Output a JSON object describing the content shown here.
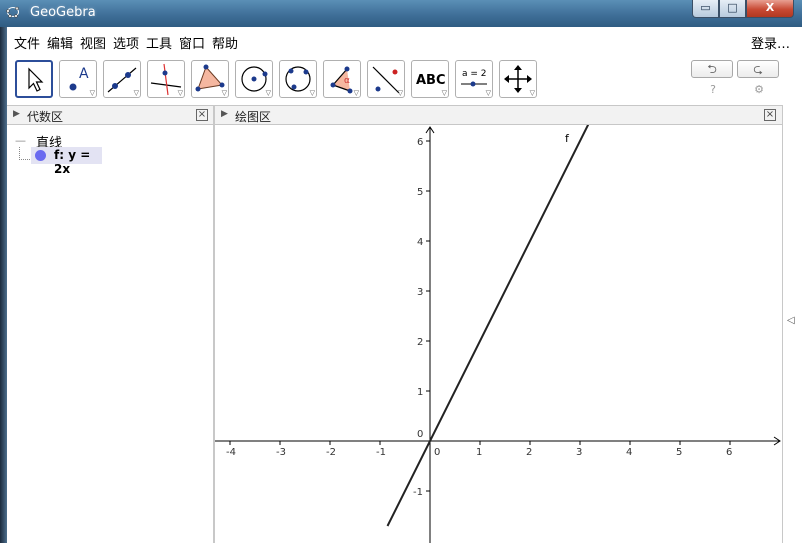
{
  "window": {
    "title": "GeoGebra",
    "controls": {
      "minimize": "▭",
      "maximize": "□",
      "close": "X"
    }
  },
  "menubar": {
    "items": [
      "文件",
      "编辑",
      "视图",
      "选项",
      "工具",
      "窗口",
      "帮助"
    ],
    "login": "登录…"
  },
  "toolbar": {
    "tools": [
      {
        "name": "move-tool"
      },
      {
        "name": "point-tool",
        "text": "A"
      },
      {
        "name": "line-tool"
      },
      {
        "name": "perpendicular-line-tool"
      },
      {
        "name": "polygon-tool"
      },
      {
        "name": "circle-tool"
      },
      {
        "name": "conic-tool"
      },
      {
        "name": "angle-tool",
        "text": "α"
      },
      {
        "name": "reflect-tool"
      },
      {
        "name": "text-tool",
        "text": "ABC"
      },
      {
        "name": "slider-tool",
        "text": "a = 2"
      },
      {
        "name": "move-graphics-tool"
      }
    ],
    "undo": "⮌",
    "redo": "⮎",
    "help": "?",
    "settings": "⚙"
  },
  "algebra_view": {
    "title": "代数区",
    "close": "×",
    "category": "直线",
    "objects": [
      {
        "label": "f: y = 2x",
        "color": "#6b6bf0"
      }
    ]
  },
  "graphics_view": {
    "title": "绘图区",
    "close": "×",
    "x_ticks": [
      "-4",
      "-3",
      "-2",
      "-1",
      "0",
      "1",
      "2",
      "3",
      "4",
      "5",
      "6"
    ],
    "y_ticks": [
      "-1",
      "1",
      "2",
      "3",
      "4",
      "5",
      "6"
    ],
    "function_label": "f",
    "function": {
      "slope": 2,
      "intercept": 0
    }
  },
  "colors": {
    "title_bar": "#3f6f98",
    "active_tool_border": "#2c4e9a",
    "object_dot": "#6b6bf0"
  }
}
